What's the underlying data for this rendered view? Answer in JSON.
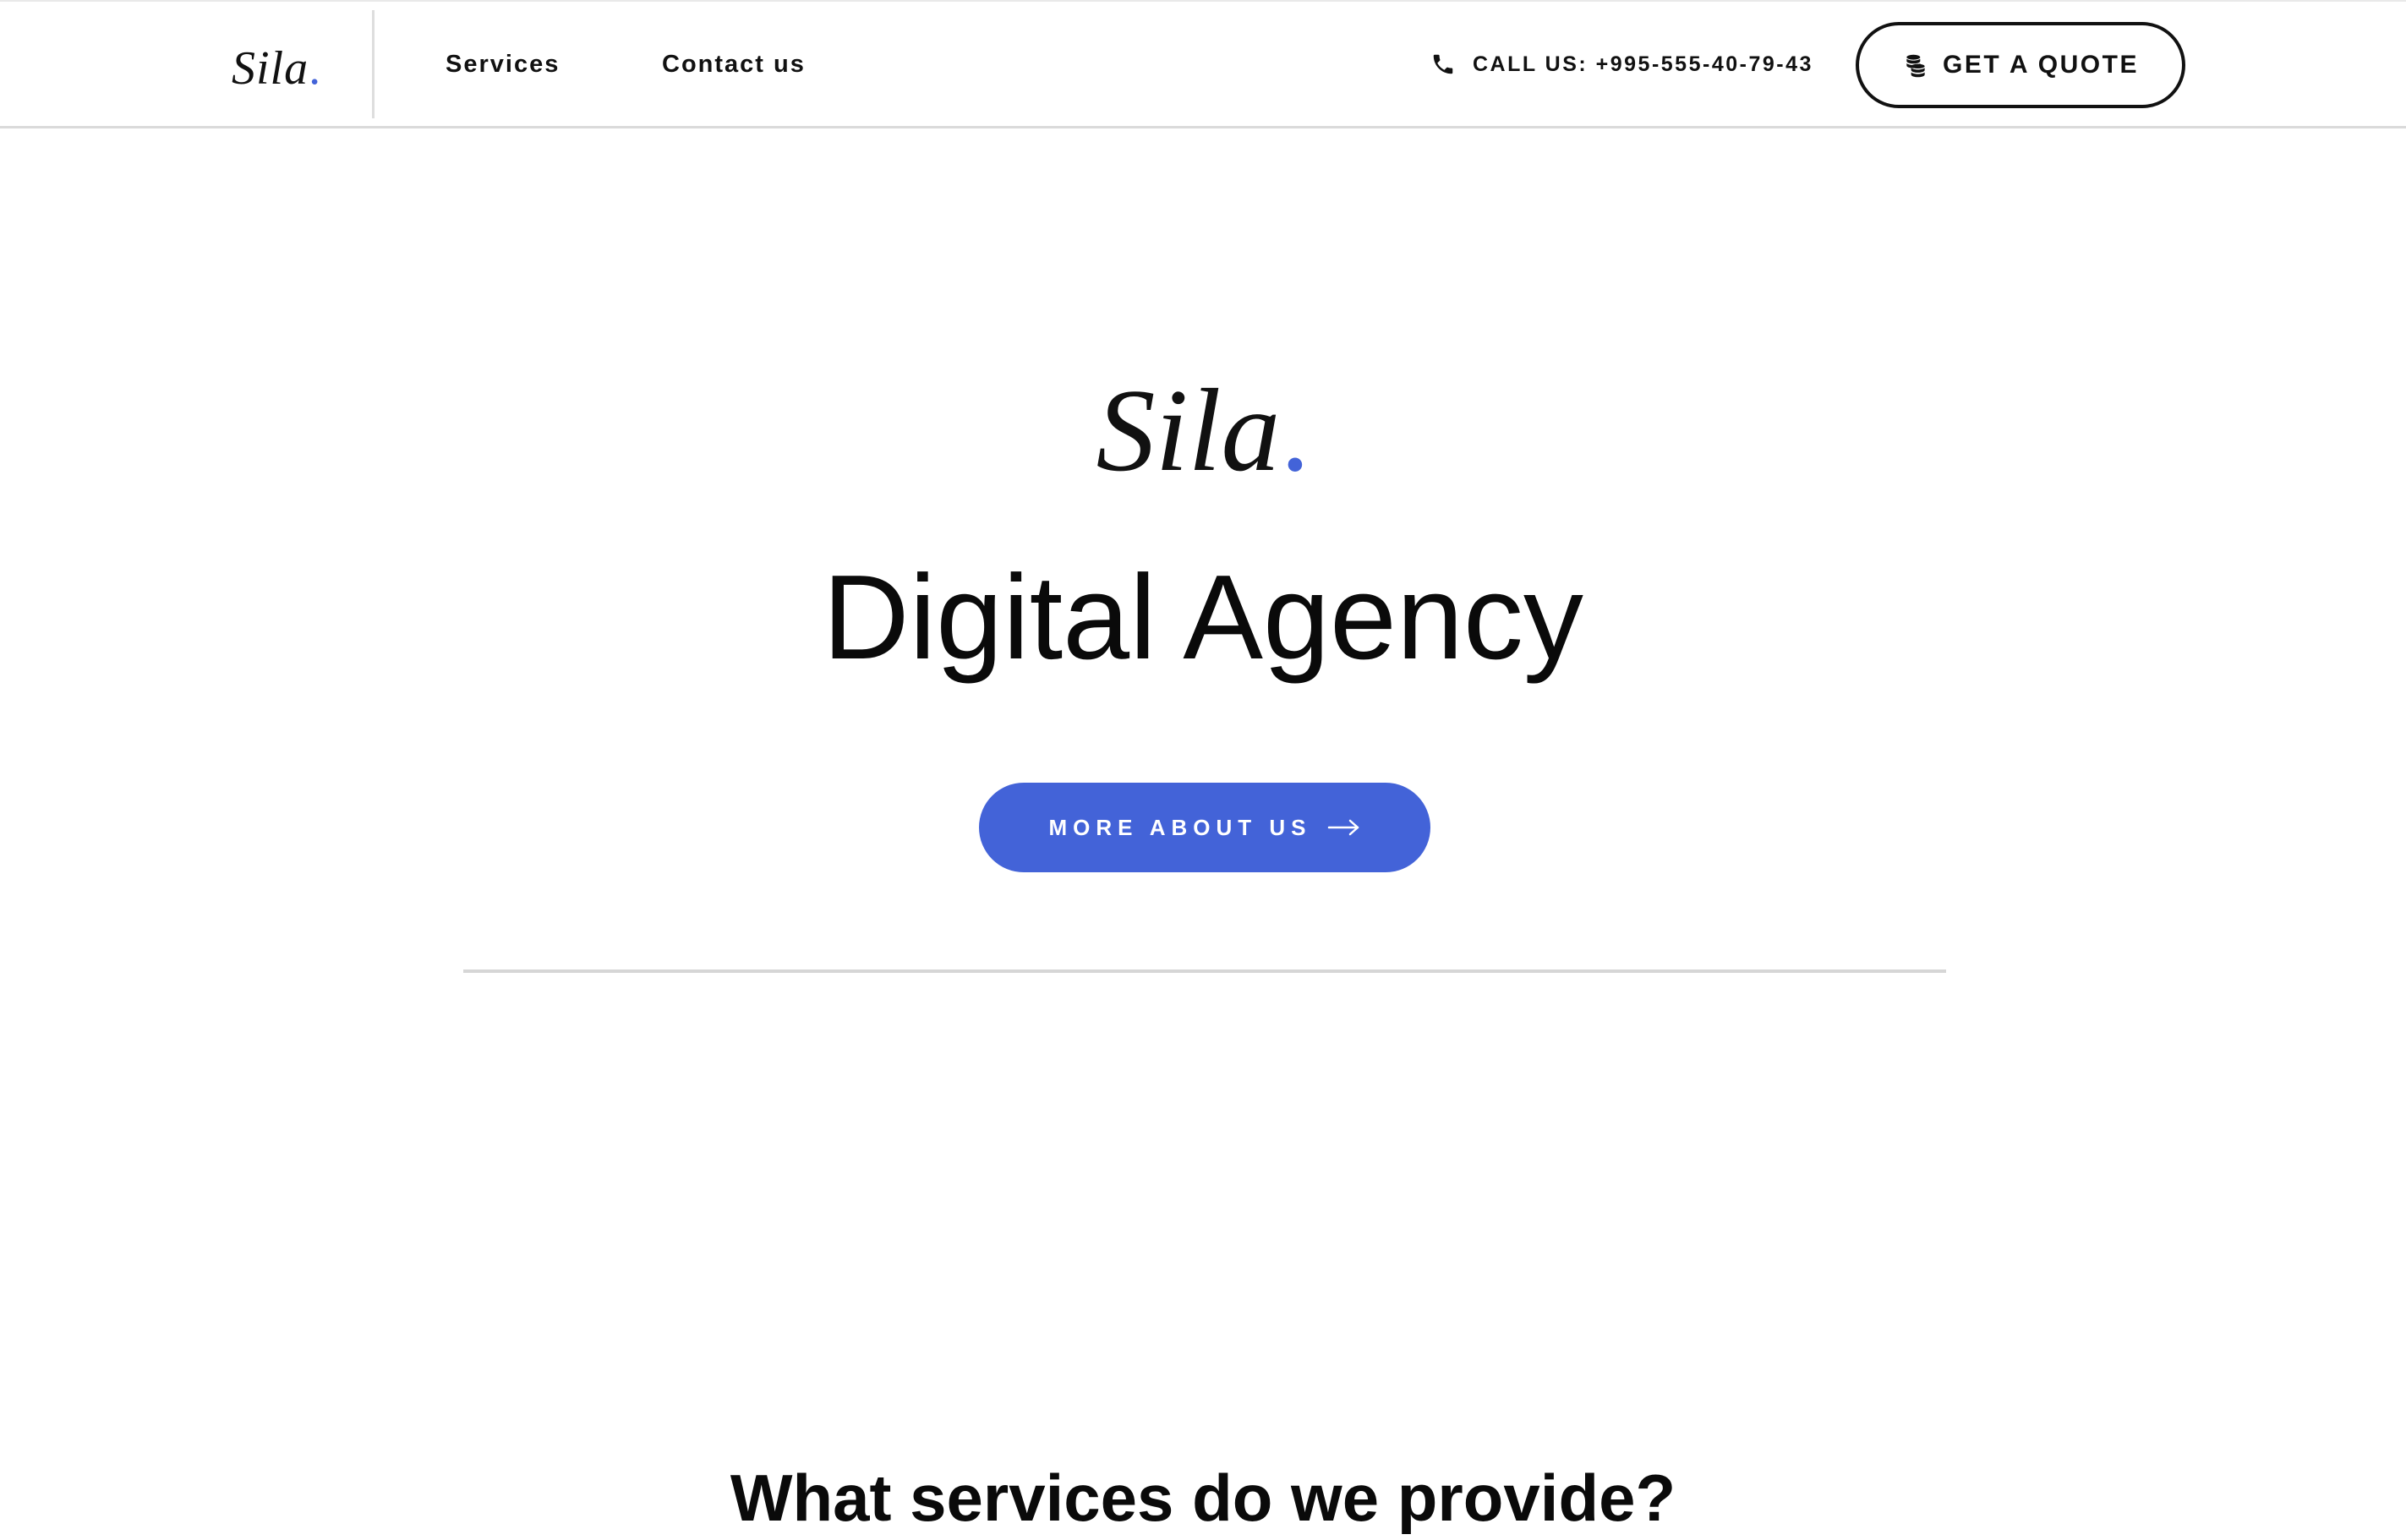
{
  "header": {
    "logo": {
      "text": "Sila",
      "dot": "."
    },
    "nav": [
      {
        "label": "Services"
      },
      {
        "label": "Contact us"
      }
    ],
    "call": {
      "text": "CALL US: +995-555-40-79-43",
      "icon": "phone-icon"
    },
    "quote_button": {
      "label": "GET A QUOTE",
      "icon": "coins-icon"
    }
  },
  "hero": {
    "logo": {
      "text": "Sila",
      "dot": "."
    },
    "title": "Digital Agency",
    "cta": {
      "label": "MORE ABOUT US",
      "icon": "arrow-right-icon"
    }
  },
  "services": {
    "heading": "What services do we provide?"
  },
  "colors": {
    "accent": "#4363d8",
    "text": "#111111",
    "background": "#ffffff",
    "divider": "#d6d6d6"
  }
}
